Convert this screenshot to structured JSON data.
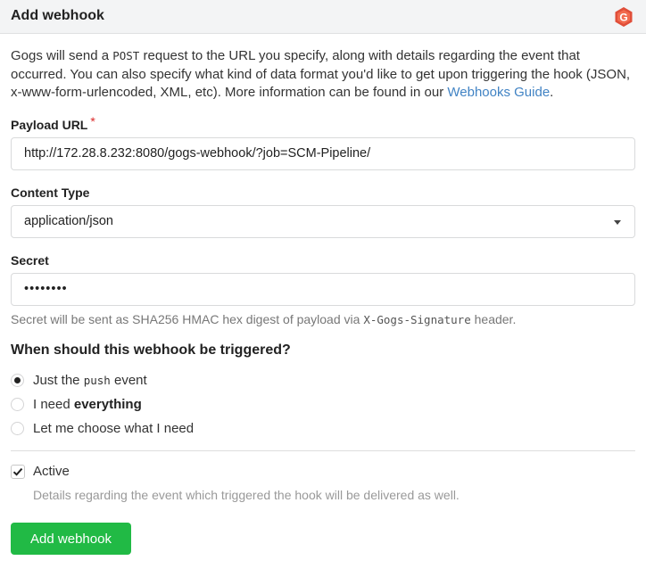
{
  "header": {
    "title": "Add webhook",
    "logo_icon": "gogs-logo-icon",
    "brand_color": "#e04e39"
  },
  "description": {
    "part1": "Gogs will send a ",
    "post": "POST",
    "part2": " request to the URL you specify, along with details regarding the event that occurred. You can also specify what kind of data format you'd like to get upon triggering the hook (JSON, x-www-form-urlencoded, XML, etc). More information can be found in our ",
    "link": "Webhooks Guide",
    "part3": "."
  },
  "payload_url": {
    "label": "Payload URL",
    "required_mark": "*",
    "value": "http://172.28.8.232:8080/gogs-webhook/?job=SCM-Pipeline/"
  },
  "content_type": {
    "label": "Content Type",
    "value": "application/json"
  },
  "secret": {
    "label": "Secret",
    "value": "••••••••",
    "help_part1": "Secret will be sent as SHA256 HMAC hex digest of payload via ",
    "help_code": "X-Gogs-Signature",
    "help_part2": " header."
  },
  "trigger": {
    "question": "When should this webhook be triggered?",
    "option_push_pre": "Just the ",
    "option_push_code": "push",
    "option_push_post": " event",
    "option_everything_pre": "I need ",
    "option_everything_bold": "everything",
    "option_choose": "Let me choose what I need",
    "selected": "push"
  },
  "active": {
    "label": "Active",
    "checked": true,
    "hint": "Details regarding the event which triggered the hook will be delivered as well."
  },
  "submit": {
    "label": "Add webhook",
    "color": "#21ba45"
  }
}
